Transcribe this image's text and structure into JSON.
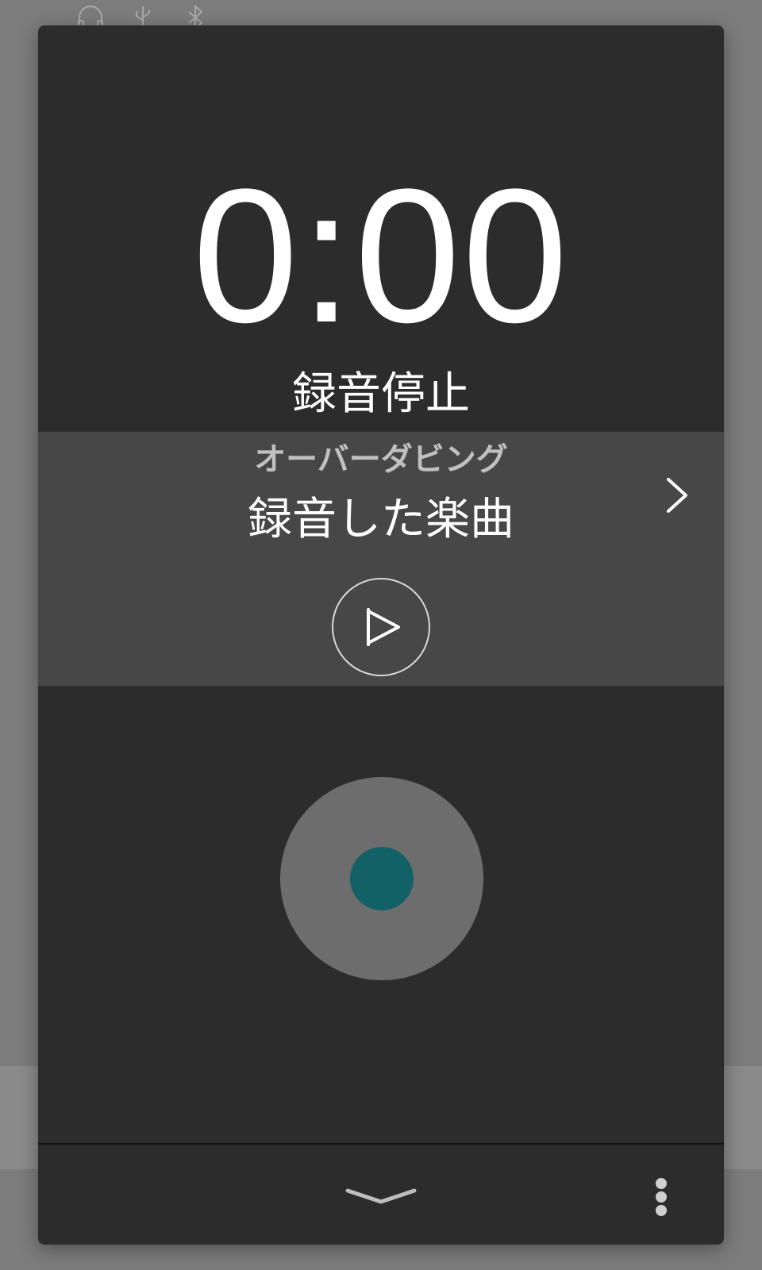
{
  "background": {
    "status_icons": [
      "headphone-icon",
      "usb-icon",
      "bluetooth-icon"
    ]
  },
  "recorder": {
    "timer": "0:00",
    "status": "録音停止"
  },
  "overdub": {
    "title": "オーバーダビング",
    "song": "録音した楽曲",
    "chevron_icon": "chevron-right-icon",
    "play_icon": "play-icon"
  },
  "record": {
    "icon": "record-icon",
    "dot_color": "#116167"
  },
  "bottom_bar": {
    "collapse_icon": "chevron-down-icon",
    "menu_icon": "more-vertical-icon"
  },
  "colors": {
    "panel": "#2c2c2c",
    "overdub_band": "#474747",
    "record_ring": "#6d6d6d",
    "accent": "#116167"
  }
}
